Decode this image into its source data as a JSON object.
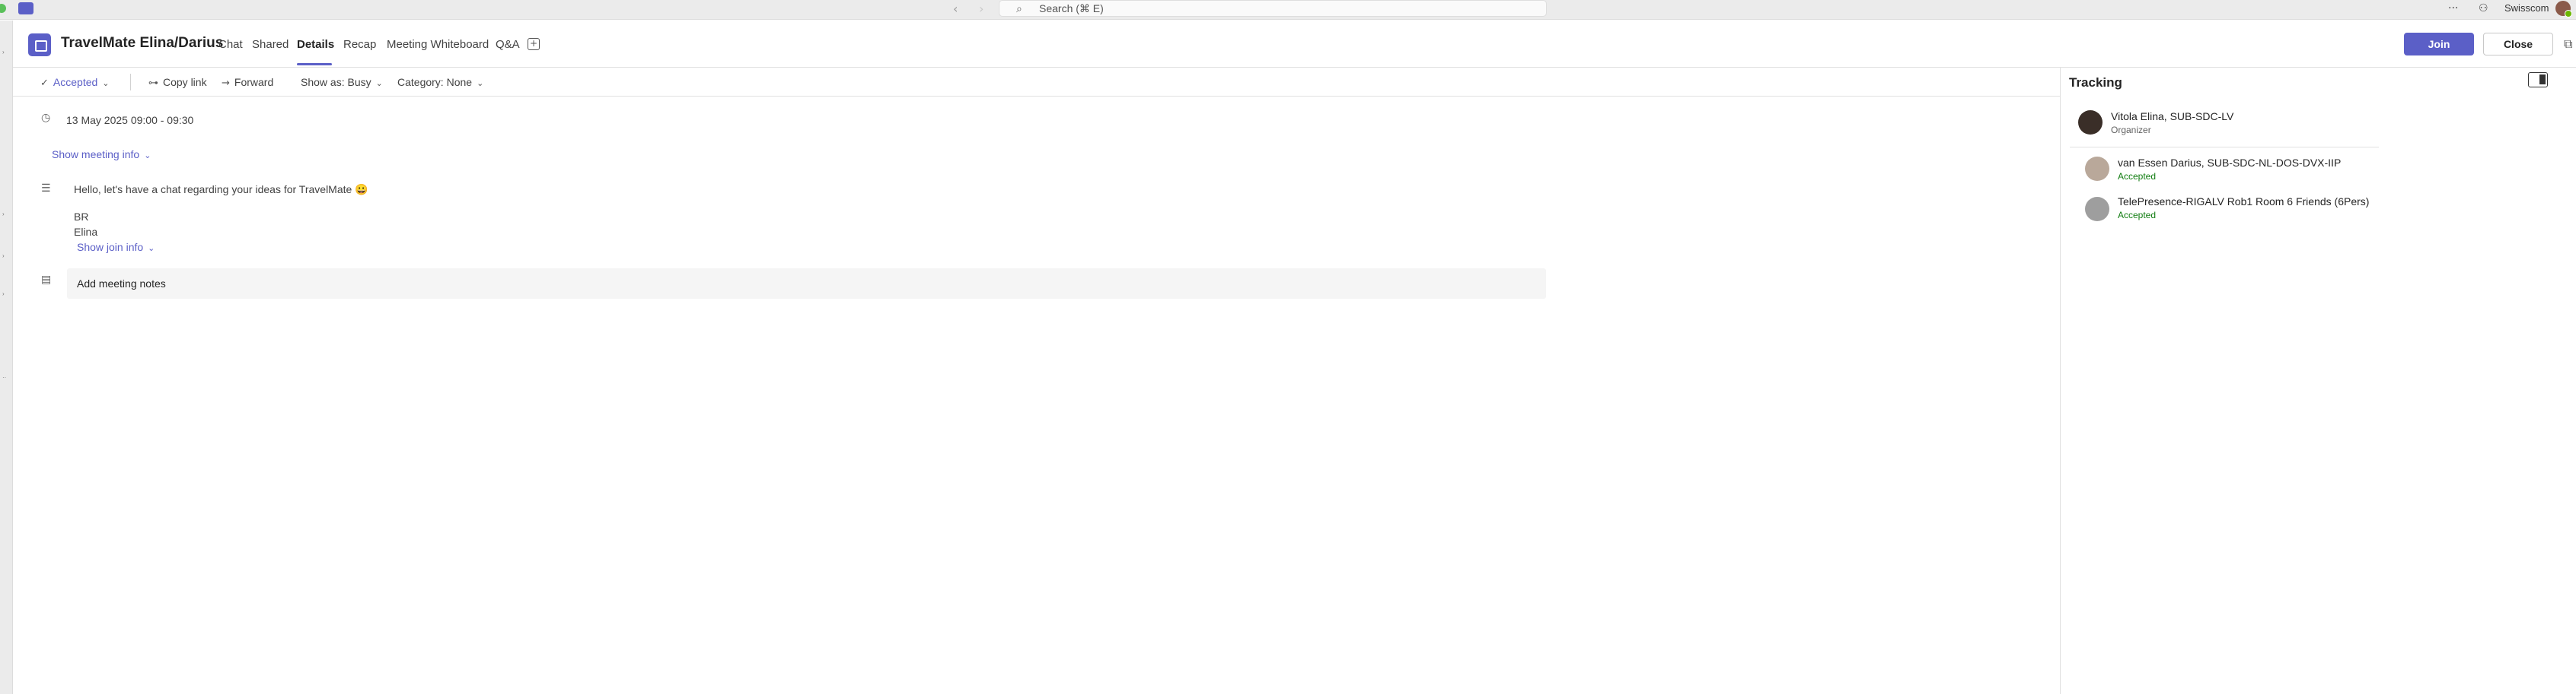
{
  "titlebar": {
    "search_placeholder": "Search (⌘ E)",
    "org_name": "Swisscom"
  },
  "header": {
    "title": "TravelMate Elina/Darius",
    "tabs": [
      {
        "label": "Chat"
      },
      {
        "label": "Shared"
      },
      {
        "label": "Details",
        "active": true
      },
      {
        "label": "Recap"
      },
      {
        "label": "Meeting Whiteboard"
      },
      {
        "label": "Q&A"
      }
    ],
    "join_label": "Join",
    "close_label": "Close"
  },
  "toolbar": {
    "response_label": "Accepted",
    "copy_link_label": "Copy link",
    "forward_label": "Forward",
    "show_as_label": "Show as: Busy",
    "category_label": "Category: None"
  },
  "details": {
    "datetime": "13 May 2025 09:00 - 09:30",
    "show_meeting_info_label": "Show meeting info",
    "body_line1": "Hello, let's have a chat regarding your ideas for TravelMate 😀",
    "body_line2": "BR",
    "body_line3": "Elina",
    "show_join_info_label": "Show join info",
    "add_notes_label": "Add meeting notes"
  },
  "tracking": {
    "title": "Tracking",
    "people": [
      {
        "name": "Vitola Elina, SUB-SDC-LV",
        "status": "Organizer"
      },
      {
        "name": "van Essen Darius, SUB-SDC-NL-DOS-DVX-IIP",
        "status": "Accepted"
      },
      {
        "name": "TelePresence-RIGALV Rob1 Room 6 Friends (6Pers)",
        "status": "Accepted"
      }
    ]
  },
  "colors": {
    "accent": "#5b5fc7",
    "accepted_green": "#107c10"
  }
}
